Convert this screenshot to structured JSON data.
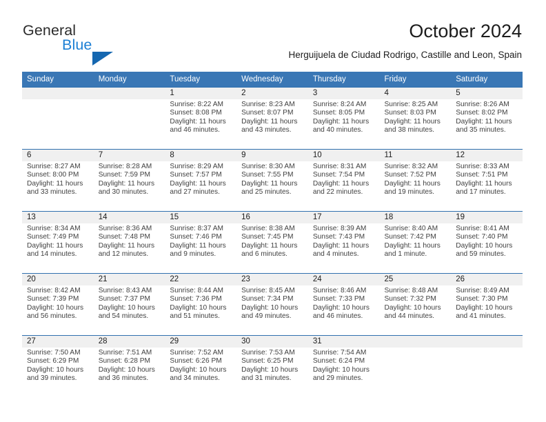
{
  "brand": {
    "name_primary": "General",
    "name_secondary": "Blue",
    "flag_icon": "flag-triangle-icon",
    "accent_color": "#1567b0"
  },
  "header": {
    "title": "October 2024",
    "subtitle": "Herguijuela de Ciudad Rodrigo, Castille and Leon, Spain"
  },
  "theme": {
    "header_blue": "#3a77b5",
    "row_border_blue": "#2f6fae",
    "date_band_gray": "#f0f0f0"
  },
  "calendar": {
    "weekdays": [
      "Sunday",
      "Monday",
      "Tuesday",
      "Wednesday",
      "Thursday",
      "Friday",
      "Saturday"
    ],
    "weeks": [
      [
        {
          "day": "",
          "empty": true
        },
        {
          "day": "",
          "empty": true
        },
        {
          "day": "1",
          "sunrise": "Sunrise: 8:22 AM",
          "sunset": "Sunset: 8:08 PM",
          "daylight": "Daylight: 11 hours and 46 minutes."
        },
        {
          "day": "2",
          "sunrise": "Sunrise: 8:23 AM",
          "sunset": "Sunset: 8:07 PM",
          "daylight": "Daylight: 11 hours and 43 minutes."
        },
        {
          "day": "3",
          "sunrise": "Sunrise: 8:24 AM",
          "sunset": "Sunset: 8:05 PM",
          "daylight": "Daylight: 11 hours and 40 minutes."
        },
        {
          "day": "4",
          "sunrise": "Sunrise: 8:25 AM",
          "sunset": "Sunset: 8:03 PM",
          "daylight": "Daylight: 11 hours and 38 minutes."
        },
        {
          "day": "5",
          "sunrise": "Sunrise: 8:26 AM",
          "sunset": "Sunset: 8:02 PM",
          "daylight": "Daylight: 11 hours and 35 minutes."
        }
      ],
      [
        {
          "day": "6",
          "sunrise": "Sunrise: 8:27 AM",
          "sunset": "Sunset: 8:00 PM",
          "daylight": "Daylight: 11 hours and 33 minutes."
        },
        {
          "day": "7",
          "sunrise": "Sunrise: 8:28 AM",
          "sunset": "Sunset: 7:59 PM",
          "daylight": "Daylight: 11 hours and 30 minutes."
        },
        {
          "day": "8",
          "sunrise": "Sunrise: 8:29 AM",
          "sunset": "Sunset: 7:57 PM",
          "daylight": "Daylight: 11 hours and 27 minutes."
        },
        {
          "day": "9",
          "sunrise": "Sunrise: 8:30 AM",
          "sunset": "Sunset: 7:55 PM",
          "daylight": "Daylight: 11 hours and 25 minutes."
        },
        {
          "day": "10",
          "sunrise": "Sunrise: 8:31 AM",
          "sunset": "Sunset: 7:54 PM",
          "daylight": "Daylight: 11 hours and 22 minutes."
        },
        {
          "day": "11",
          "sunrise": "Sunrise: 8:32 AM",
          "sunset": "Sunset: 7:52 PM",
          "daylight": "Daylight: 11 hours and 19 minutes."
        },
        {
          "day": "12",
          "sunrise": "Sunrise: 8:33 AM",
          "sunset": "Sunset: 7:51 PM",
          "daylight": "Daylight: 11 hours and 17 minutes."
        }
      ],
      [
        {
          "day": "13",
          "sunrise": "Sunrise: 8:34 AM",
          "sunset": "Sunset: 7:49 PM",
          "daylight": "Daylight: 11 hours and 14 minutes."
        },
        {
          "day": "14",
          "sunrise": "Sunrise: 8:36 AM",
          "sunset": "Sunset: 7:48 PM",
          "daylight": "Daylight: 11 hours and 12 minutes."
        },
        {
          "day": "15",
          "sunrise": "Sunrise: 8:37 AM",
          "sunset": "Sunset: 7:46 PM",
          "daylight": "Daylight: 11 hours and 9 minutes."
        },
        {
          "day": "16",
          "sunrise": "Sunrise: 8:38 AM",
          "sunset": "Sunset: 7:45 PM",
          "daylight": "Daylight: 11 hours and 6 minutes."
        },
        {
          "day": "17",
          "sunrise": "Sunrise: 8:39 AM",
          "sunset": "Sunset: 7:43 PM",
          "daylight": "Daylight: 11 hours and 4 minutes."
        },
        {
          "day": "18",
          "sunrise": "Sunrise: 8:40 AM",
          "sunset": "Sunset: 7:42 PM",
          "daylight": "Daylight: 11 hours and 1 minute."
        },
        {
          "day": "19",
          "sunrise": "Sunrise: 8:41 AM",
          "sunset": "Sunset: 7:40 PM",
          "daylight": "Daylight: 10 hours and 59 minutes."
        }
      ],
      [
        {
          "day": "20",
          "sunrise": "Sunrise: 8:42 AM",
          "sunset": "Sunset: 7:39 PM",
          "daylight": "Daylight: 10 hours and 56 minutes."
        },
        {
          "day": "21",
          "sunrise": "Sunrise: 8:43 AM",
          "sunset": "Sunset: 7:37 PM",
          "daylight": "Daylight: 10 hours and 54 minutes."
        },
        {
          "day": "22",
          "sunrise": "Sunrise: 8:44 AM",
          "sunset": "Sunset: 7:36 PM",
          "daylight": "Daylight: 10 hours and 51 minutes."
        },
        {
          "day": "23",
          "sunrise": "Sunrise: 8:45 AM",
          "sunset": "Sunset: 7:34 PM",
          "daylight": "Daylight: 10 hours and 49 minutes."
        },
        {
          "day": "24",
          "sunrise": "Sunrise: 8:46 AM",
          "sunset": "Sunset: 7:33 PM",
          "daylight": "Daylight: 10 hours and 46 minutes."
        },
        {
          "day": "25",
          "sunrise": "Sunrise: 8:48 AM",
          "sunset": "Sunset: 7:32 PM",
          "daylight": "Daylight: 10 hours and 44 minutes."
        },
        {
          "day": "26",
          "sunrise": "Sunrise: 8:49 AM",
          "sunset": "Sunset: 7:30 PM",
          "daylight": "Daylight: 10 hours and 41 minutes."
        }
      ],
      [
        {
          "day": "27",
          "sunrise": "Sunrise: 7:50 AM",
          "sunset": "Sunset: 6:29 PM",
          "daylight": "Daylight: 10 hours and 39 minutes."
        },
        {
          "day": "28",
          "sunrise": "Sunrise: 7:51 AM",
          "sunset": "Sunset: 6:28 PM",
          "daylight": "Daylight: 10 hours and 36 minutes."
        },
        {
          "day": "29",
          "sunrise": "Sunrise: 7:52 AM",
          "sunset": "Sunset: 6:26 PM",
          "daylight": "Daylight: 10 hours and 34 minutes."
        },
        {
          "day": "30",
          "sunrise": "Sunrise: 7:53 AM",
          "sunset": "Sunset: 6:25 PM",
          "daylight": "Daylight: 10 hours and 31 minutes."
        },
        {
          "day": "31",
          "sunrise": "Sunrise: 7:54 AM",
          "sunset": "Sunset: 6:24 PM",
          "daylight": "Daylight: 10 hours and 29 minutes."
        },
        {
          "day": "",
          "empty": true
        },
        {
          "day": "",
          "empty": true
        }
      ]
    ]
  }
}
